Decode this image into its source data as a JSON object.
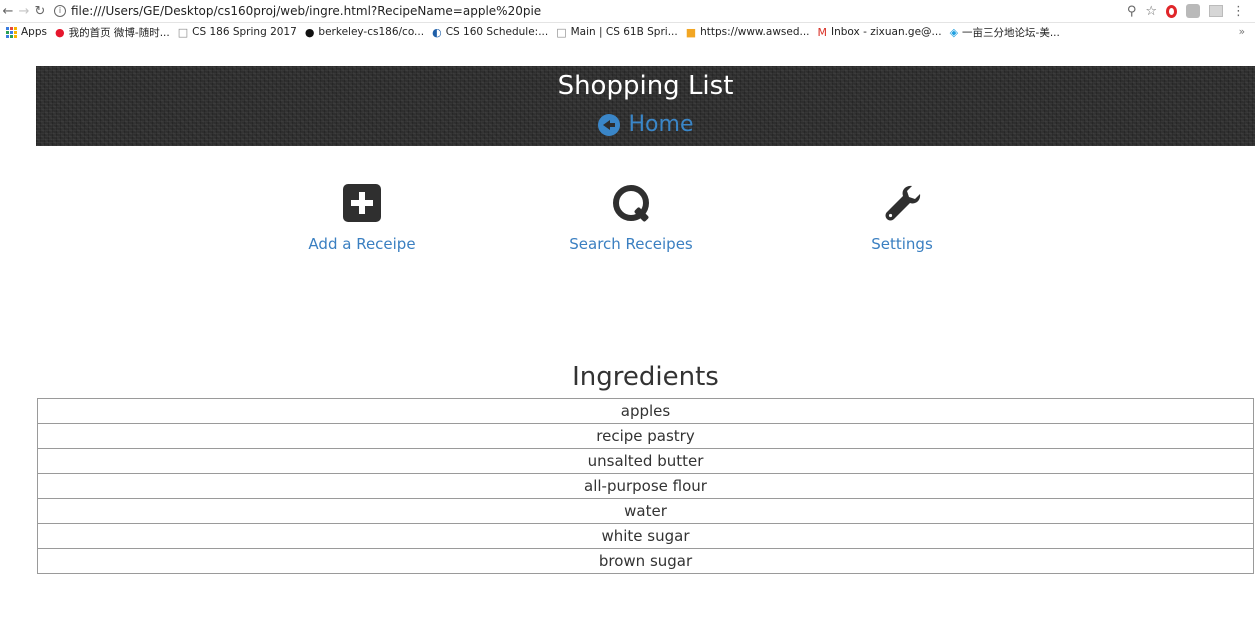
{
  "browser": {
    "url": "file:///Users/GE/Desktop/cs160proj/web/ingre.html?RecipeName=apple%20pie",
    "bookmarks": [
      {
        "label": "Apps",
        "icon": "apps-grid-icon"
      },
      {
        "label": "我的首页 微博-随时...",
        "icon": "weibo-icon"
      },
      {
        "label": "CS 186 Spring 2017",
        "icon": "page-icon"
      },
      {
        "label": "berkeley-cs186/co...",
        "icon": "github-icon"
      },
      {
        "label": "CS 160 Schedule:...",
        "icon": "site-icon"
      },
      {
        "label": "Main | CS 61B Spri...",
        "icon": "page-icon"
      },
      {
        "label": "https://www.awsed...",
        "icon": "aws-icon"
      },
      {
        "label": "Inbox - zixuan.ge@...",
        "icon": "gmail-icon"
      },
      {
        "label": "一亩三分地论坛-美...",
        "icon": "forum-icon"
      }
    ],
    "more": "»"
  },
  "header": {
    "title": "Shopping List",
    "home_label": "Home"
  },
  "actions": {
    "add_label": "Add a Receipe",
    "search_label": "Search Receipes",
    "settings_label": "Settings"
  },
  "ingredients": {
    "title": "Ingredients",
    "items": [
      "apples",
      "recipe pastry",
      "unsalted butter",
      "all-purpose flour",
      "water",
      "white sugar",
      "brown sugar"
    ]
  },
  "colors": {
    "link": "#3a86c8",
    "header_bg": "#2e2e2e",
    "icon_dark": "#2f2f2f"
  }
}
